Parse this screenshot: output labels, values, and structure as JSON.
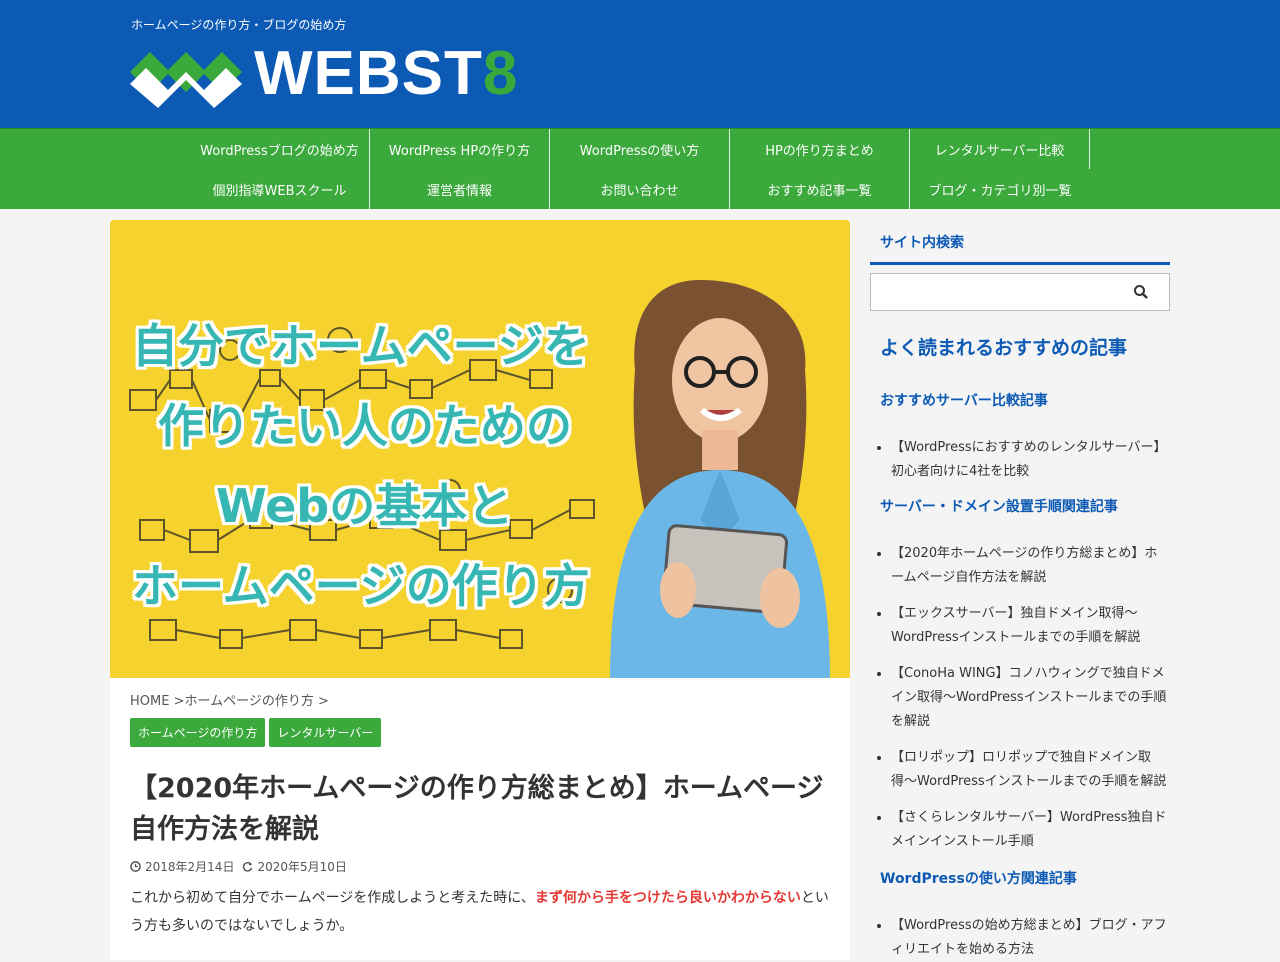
{
  "header": {
    "tagline": "ホームページの作り方・ブログの始め方",
    "logo_text": "WEBST",
    "logo_digit": "8",
    "brand_blue": "#0d5ab5",
    "brand_green": "#3ba93b"
  },
  "nav": {
    "row1": [
      "WordPressブログの始め方",
      "WordPress HPの作り方",
      "WordPressの使い方",
      "HPの作り方まとめ",
      "レンタルサーバー比較"
    ],
    "row2": [
      "個別指導WEBスクール",
      "運営者情報",
      "お問い合わせ",
      "おすすめ記事一覧",
      "ブログ・カテゴリ別一覧"
    ]
  },
  "hero": {
    "lines": [
      "自分でホームページを",
      "作りたい人のための",
      "Webの基本と",
      "ホームページの作り方"
    ]
  },
  "article": {
    "breadcrumb": "HOME >ホームページの作り方 >",
    "tags": [
      "ホームページの作り方",
      "レンタルサーバー"
    ],
    "title": "【2020年ホームページの作り方総まとめ】ホームページ自作方法を解説",
    "published": "2018年2月14日",
    "updated": "2020年5月10日",
    "intro_before": "これから初めて自分でホームページを作成しようと考えた時に、",
    "intro_highlight": "まず何から手をつけたら良いかわからない",
    "intro_after": "という方も多いのではないでしょうか。"
  },
  "sidebar": {
    "search_heading": "サイト内検索",
    "search_placeholder": "",
    "popular_heading": "よく読まれるおすすめの記事",
    "sections": [
      {
        "title": "おすすめサーバー比較記事",
        "items": [
          "【WordPressにおすすめのレンタルサーバー】初心者向けに4社を比較"
        ]
      },
      {
        "title": "サーバー・ドメイン設置手順関連記事",
        "items": [
          "【2020年ホームページの作り方総まとめ】ホームページ自作方法を解説",
          "【エックスサーバー】独自ドメイン取得〜WordPressインストールまでの手順を解説",
          "【ConoHa WING】コノハウィングで独自ドメイン取得〜WordPressインストールまでの手順を解説",
          "【ロリポップ】ロリポップで独自ドメイン取得〜WordPressインストールまでの手順を解説",
          "【さくらレンタルサーバー】WordPress独自ドメインインストール手順"
        ]
      },
      {
        "title": "WordPressの使い方関連記事",
        "items": [
          "【WordPressの始め方総まとめ】ブログ・アフィリエイトを始める方法"
        ]
      }
    ]
  }
}
